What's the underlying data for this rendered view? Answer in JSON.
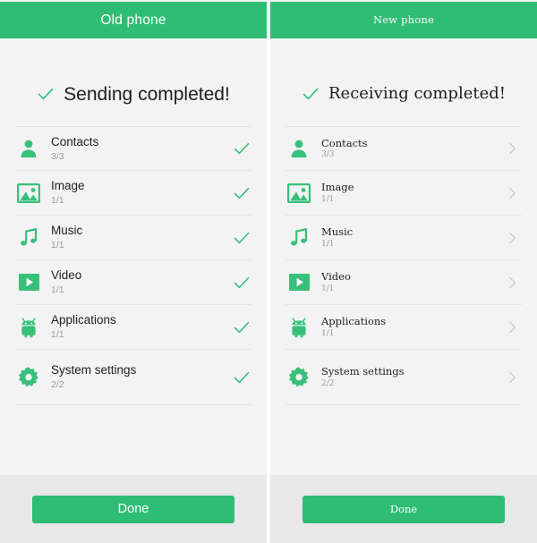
{
  "theme": {
    "accent": "#2fbd74",
    "page_bg": "#f3f3f3",
    "footer_bg": "#e8e8e8",
    "divider": "#e4e4e4",
    "title_text": "#212121",
    "count_text": "#9a9a9a",
    "chevron": "#c9c9c9"
  },
  "panels": [
    {
      "id": "old-phone",
      "header_title": "Old phone",
      "status_text": "Sending completed!",
      "status_icon": "check-icon",
      "trail_icon": "check-icon",
      "items": [
        {
          "icon": "contacts-icon",
          "label": "Contacts",
          "count": "3/3"
        },
        {
          "icon": "image-icon",
          "label": "Image",
          "count": "1/1"
        },
        {
          "icon": "music-icon",
          "label": "Music",
          "count": "1/1"
        },
        {
          "icon": "video-icon",
          "label": "Video",
          "count": "1/1"
        },
        {
          "icon": "applications-icon",
          "label": "Applications",
          "count": "1/1"
        },
        {
          "icon": "system-settings-icon",
          "label": "System settings",
          "count": "2/2"
        }
      ],
      "done_label": "Done"
    },
    {
      "id": "new-phone",
      "header_title": "New phone",
      "status_text": "Receiving completed!",
      "status_icon": "check-icon",
      "trail_icon": "chevron-right-icon",
      "items": [
        {
          "icon": "contacts-icon",
          "label": "Contacts",
          "count": "3/3"
        },
        {
          "icon": "image-icon",
          "label": "Image",
          "count": "1/1"
        },
        {
          "icon": "music-icon",
          "label": "Music",
          "count": "1/1"
        },
        {
          "icon": "video-icon",
          "label": "Video",
          "count": "1/1"
        },
        {
          "icon": "applications-icon",
          "label": "Applications",
          "count": "1/1"
        },
        {
          "icon": "system-settings-icon",
          "label": "System settings",
          "count": "2/2"
        }
      ],
      "done_label": "Done"
    }
  ]
}
